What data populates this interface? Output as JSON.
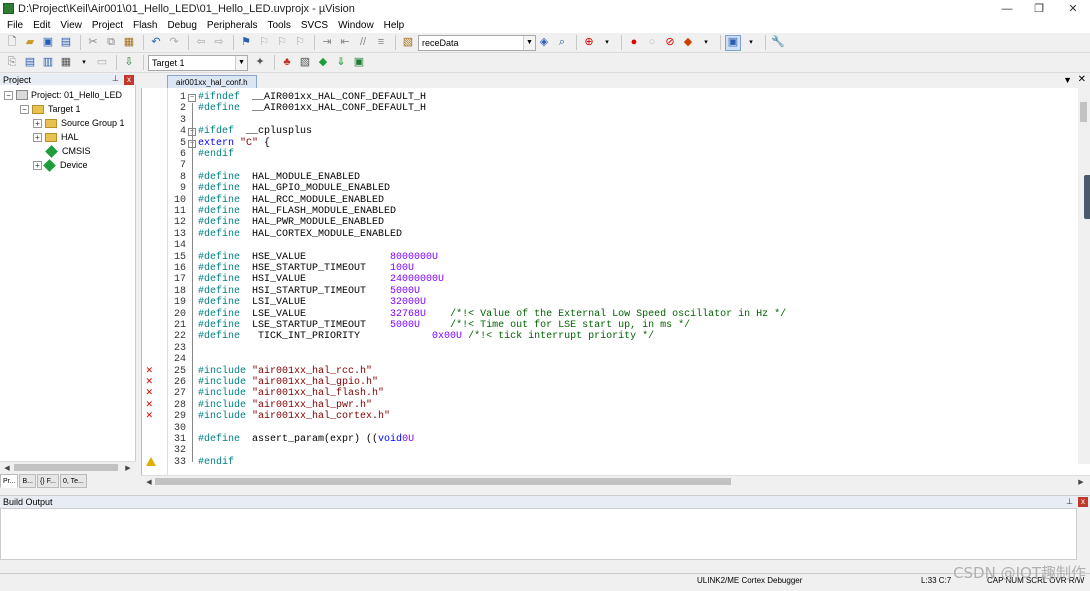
{
  "window": {
    "title": "D:\\Project\\Keil\\Air001\\01_Hello_LED\\01_Hello_LED.uvprojx - µVision",
    "minimize": "—",
    "maximize": "❐",
    "close": "✕"
  },
  "menu": [
    "File",
    "Edit",
    "View",
    "Project",
    "Flash",
    "Debug",
    "Peripherals",
    "Tools",
    "SVCS",
    "Window",
    "Help"
  ],
  "toolbar": {
    "find_combo_value": "receData",
    "target_combo_value": "Target 1"
  },
  "project_panel": {
    "title": "Project",
    "tree": [
      {
        "label": "Project: 01_Hello_LED",
        "icon": "project-icon",
        "level": 0,
        "expander": "−"
      },
      {
        "label": "Target 1",
        "icon": "folder-icon",
        "level": 1,
        "expander": "−"
      },
      {
        "label": "Source Group 1",
        "icon": "folder-icon",
        "level": 2,
        "expander": "+"
      },
      {
        "label": "HAL",
        "icon": "folder-icon",
        "level": 2,
        "expander": "+"
      },
      {
        "label": "CMSIS",
        "icon": "diamond-icon",
        "level": 2,
        "expander": ""
      },
      {
        "label": "Device",
        "icon": "diamond-icon",
        "level": 2,
        "expander": "+"
      }
    ],
    "tabs": [
      "Pr...",
      "B...",
      "{} F...",
      "0, Te..."
    ]
  },
  "editor": {
    "active_tab": "air001xx_hal_conf.h",
    "lines": [
      {
        "n": "1",
        "fold": "−",
        "t": [
          [
            "kw",
            "#ifndef"
          ],
          [
            "",
            "  __AIR001xx_HAL_CONF_DEFAULT_H"
          ]
        ]
      },
      {
        "n": "2",
        "t": [
          [
            "kw",
            "#define"
          ],
          [
            "",
            "  __AIR001xx_HAL_CONF_DEFAULT_H"
          ]
        ]
      },
      {
        "n": "3",
        "t": []
      },
      {
        "n": "4",
        "fold": "−",
        "t": [
          [
            "kw",
            "#ifdef"
          ],
          [
            "",
            "  __cplusplus"
          ]
        ]
      },
      {
        "n": "5",
        "fold": "−",
        "t": [
          [
            "kw2",
            "extern"
          ],
          [
            "",
            " "
          ],
          [
            "str",
            "\"C\""
          ],
          [
            "",
            " {"
          ]
        ]
      },
      {
        "n": "6",
        "t": [
          [
            "kw",
            "#endif"
          ]
        ]
      },
      {
        "n": "7",
        "t": []
      },
      {
        "n": "8",
        "t": [
          [
            "kw",
            "#define"
          ],
          [
            "",
            "  HAL_MODULE_ENABLED"
          ]
        ]
      },
      {
        "n": "9",
        "t": [
          [
            "kw",
            "#define"
          ],
          [
            "",
            "  HAL_GPIO_MODULE_ENABLED"
          ]
        ]
      },
      {
        "n": "10",
        "t": [
          [
            "kw",
            "#define"
          ],
          [
            "",
            "  HAL_RCC_MODULE_ENABLED"
          ]
        ]
      },
      {
        "n": "11",
        "t": [
          [
            "kw",
            "#define"
          ],
          [
            "",
            "  HAL_FLASH_MODULE_ENABLED"
          ]
        ]
      },
      {
        "n": "12",
        "t": [
          [
            "kw",
            "#define"
          ],
          [
            "",
            "  HAL_PWR_MODULE_ENABLED"
          ]
        ]
      },
      {
        "n": "13",
        "t": [
          [
            "kw",
            "#define"
          ],
          [
            "",
            "  HAL_CORTEX_MODULE_ENABLED"
          ]
        ]
      },
      {
        "n": "14",
        "t": []
      },
      {
        "n": "15",
        "t": [
          [
            "kw",
            "#define"
          ],
          [
            "",
            "  HSE_VALUE              "
          ],
          [
            "num",
            "8000000U"
          ]
        ]
      },
      {
        "n": "16",
        "t": [
          [
            "kw",
            "#define"
          ],
          [
            "",
            "  HSE_STARTUP_TIMEOUT    "
          ],
          [
            "num",
            "100U"
          ]
        ]
      },
      {
        "n": "17",
        "t": [
          [
            "kw",
            "#define"
          ],
          [
            "",
            "  HSI_VALUE              "
          ],
          [
            "num",
            "24000000U"
          ]
        ]
      },
      {
        "n": "18",
        "t": [
          [
            "kw",
            "#define"
          ],
          [
            "",
            "  HSI_STARTUP_TIMEOUT    "
          ],
          [
            "num",
            "5000U"
          ]
        ]
      },
      {
        "n": "19",
        "t": [
          [
            "kw",
            "#define"
          ],
          [
            "",
            "  LSI_VALUE              "
          ],
          [
            "num",
            "32000U"
          ]
        ]
      },
      {
        "n": "20",
        "t": [
          [
            "kw",
            "#define"
          ],
          [
            "",
            "  LSE_VALUE              "
          ],
          [
            "num",
            "32768U"
          ],
          [
            "",
            "    "
          ],
          [
            "cmt",
            "/*!< Value of the External Low Speed oscillator in Hz */"
          ]
        ]
      },
      {
        "n": "21",
        "t": [
          [
            "kw",
            "#define"
          ],
          [
            "",
            "  LSE_STARTUP_TIMEOUT    "
          ],
          [
            "num",
            "5000U"
          ],
          [
            "",
            "     "
          ],
          [
            "cmt",
            "/*!< Time out for LSE start up, in ms */"
          ]
        ]
      },
      {
        "n": "22",
        "t": [
          [
            "kw",
            "#define"
          ],
          [
            "",
            "   TICK_INT_PRIORITY            "
          ],
          [
            "num",
            "0x00U"
          ],
          [
            "",
            " "
          ],
          [
            "cmt",
            "/*!< tick interrupt priority */"
          ]
        ]
      },
      {
        "n": "23",
        "t": []
      },
      {
        "n": "24",
        "t": []
      },
      {
        "n": "25",
        "mark": "error",
        "t": [
          [
            "kw",
            "#include"
          ],
          [
            "",
            " "
          ],
          [
            "str",
            "\"air001xx_hal_rcc.h\""
          ]
        ]
      },
      {
        "n": "26",
        "mark": "error",
        "t": [
          [
            "kw",
            "#include"
          ],
          [
            "",
            " "
          ],
          [
            "str",
            "\"air001xx_hal_gpio.h\""
          ]
        ]
      },
      {
        "n": "27",
        "mark": "error",
        "t": [
          [
            "kw",
            "#include"
          ],
          [
            "",
            " "
          ],
          [
            "str",
            "\"air001xx_hal_flash.h\""
          ]
        ]
      },
      {
        "n": "28",
        "mark": "error",
        "t": [
          [
            "kw",
            "#include"
          ],
          [
            "",
            " "
          ],
          [
            "str",
            "\"air001xx_hal_pwr.h\""
          ]
        ]
      },
      {
        "n": "29",
        "mark": "error",
        "t": [
          [
            "kw",
            "#include"
          ],
          [
            "",
            " "
          ],
          [
            "str",
            "\"air001xx_hal_cortex.h\""
          ]
        ]
      },
      {
        "n": "30",
        "t": []
      },
      {
        "n": "31",
        "t": [
          [
            "kw",
            "#define"
          ],
          [
            "",
            "  assert_param(expr) (("
          ],
          [
            "kw2",
            "void"
          ],
          [
            ")"
          ],
          [
            "num",
            "0U"
          ],
          [
            ")"
          ]
        ]
      },
      {
        "n": "32",
        "t": []
      },
      {
        "n": "33",
        "mark": "warning",
        "t": [
          [
            "kw",
            "#endif"
          ]
        ]
      }
    ]
  },
  "build_output": {
    "title": "Build Output"
  },
  "status": {
    "debugger": "ULINK2/ME Cortex Debugger",
    "position": "L:33 C:7",
    "flags": "CAP  NUM  SCRL  OVR  R/W"
  },
  "watermark": "CSDN @IOT趣制作"
}
